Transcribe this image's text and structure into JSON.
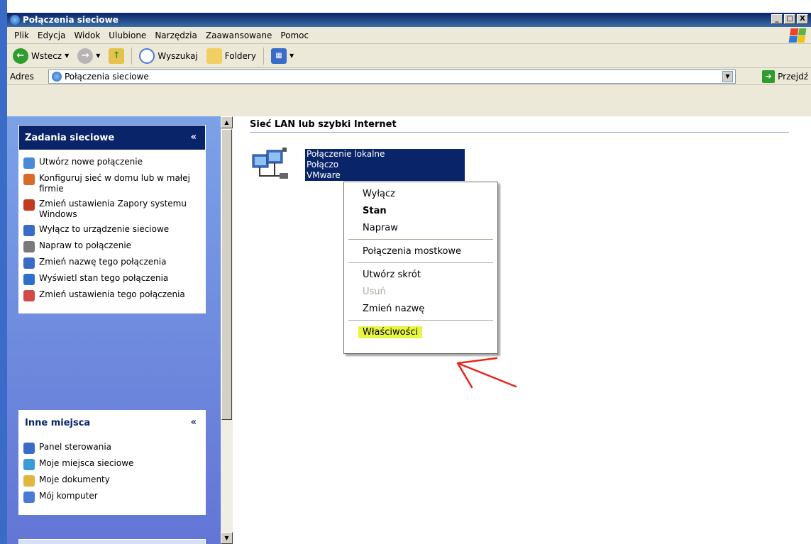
{
  "window": {
    "title": "Połączenia sieciowe",
    "buttons": [
      "_",
      "□",
      "X"
    ]
  },
  "menu": [
    "Plik",
    "Edycja",
    "Widok",
    "Ulubione",
    "Narzędzia",
    "Zaawansowane",
    "Pomoc"
  ],
  "toolbar": {
    "back": "Wstecz",
    "search": "Wyszukaj",
    "folders": "Foldery"
  },
  "address": {
    "label": "Adres",
    "value": "Połączenia sieciowe",
    "go": "Przejdź"
  },
  "tasks": {
    "title": "Zadania sieciowe",
    "items": [
      {
        "label": "Utwórz nowe połączenie",
        "icon": "new-connection-icon",
        "color": "#4a8ad6"
      },
      {
        "label": "Konfiguruj sieć w domu lub w małej firmie",
        "icon": "home-network-icon",
        "color": "#d86b2a"
      },
      {
        "label": "Zmień ustawienia Zapory systemu Windows",
        "icon": "firewall-icon",
        "color": "#c03b1f"
      },
      {
        "label": "Wyłącz to urządzenie sieciowe",
        "icon": "disable-network-icon",
        "color": "#3a6cc7"
      },
      {
        "label": "Napraw to połączenie",
        "icon": "wrench-icon",
        "color": "#7a7a7a"
      },
      {
        "label": "Zmień nazwę tego połączenia",
        "icon": "rename-icon",
        "color": "#3a6cc7"
      },
      {
        "label": "Wyświetl stan tego połączenia",
        "icon": "status-icon",
        "color": "#2e6fc9"
      },
      {
        "label": "Zmień ustawienia tego połączenia",
        "icon": "settings-doc-icon",
        "color": "#d04a4a"
      }
    ]
  },
  "other": {
    "title": "Inne miejsca",
    "items": [
      {
        "label": "Panel sterowania",
        "icon": "control-panel-icon",
        "color": "#3a6cc7"
      },
      {
        "label": "Moje miejsca sieciowe",
        "icon": "network-places-icon",
        "color": "#3a9bd6"
      },
      {
        "label": "Moje dokumenty",
        "icon": "my-documents-icon",
        "color": "#e0b640"
      },
      {
        "label": "Mój komputer",
        "icon": "my-computer-icon",
        "color": "#4a7ad6"
      }
    ]
  },
  "content": {
    "section": "Sieć LAN lub szybki Internet",
    "connection": {
      "line1": "Połączenie lokalne",
      "line2": "Połączo",
      "line3": "VMware"
    }
  },
  "context_menu": {
    "items": [
      "Wyłącz",
      "Stan",
      "Napraw",
      "Połączenia mostkowe",
      "Utwórz skrót",
      "Usuń",
      "Zmień nazwę",
      "Właściwości"
    ]
  }
}
